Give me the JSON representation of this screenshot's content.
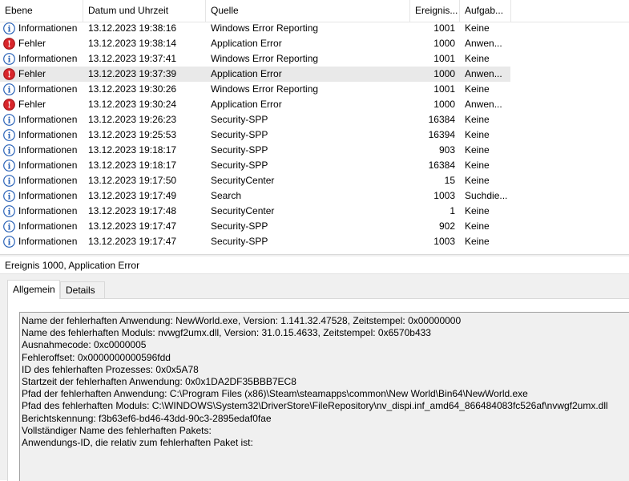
{
  "columns": {
    "level": "Ebene",
    "datetime": "Datum und Uhrzeit",
    "source": "Quelle",
    "event_id": "Ereignis...",
    "task": "Aufgab..."
  },
  "rows": [
    {
      "level": "Informationen",
      "type": "info",
      "datetime": "13.12.2023 19:38:16",
      "source": "Windows Error Reporting",
      "event_id": "1001",
      "task": "Keine",
      "selected": false
    },
    {
      "level": "Fehler",
      "type": "error",
      "datetime": "13.12.2023 19:38:14",
      "source": "Application Error",
      "event_id": "1000",
      "task": "Anwen...",
      "selected": false
    },
    {
      "level": "Informationen",
      "type": "info",
      "datetime": "13.12.2023 19:37:41",
      "source": "Windows Error Reporting",
      "event_id": "1001",
      "task": "Keine",
      "selected": false
    },
    {
      "level": "Fehler",
      "type": "error",
      "datetime": "13.12.2023 19:37:39",
      "source": "Application Error",
      "event_id": "1000",
      "task": "Anwen...",
      "selected": true
    },
    {
      "level": "Informationen",
      "type": "info",
      "datetime": "13.12.2023 19:30:26",
      "source": "Windows Error Reporting",
      "event_id": "1001",
      "task": "Keine",
      "selected": false
    },
    {
      "level": "Fehler",
      "type": "error",
      "datetime": "13.12.2023 19:30:24",
      "source": "Application Error",
      "event_id": "1000",
      "task": "Anwen...",
      "selected": false
    },
    {
      "level": "Informationen",
      "type": "info",
      "datetime": "13.12.2023 19:26:23",
      "source": "Security-SPP",
      "event_id": "16384",
      "task": "Keine",
      "selected": false
    },
    {
      "level": "Informationen",
      "type": "info",
      "datetime": "13.12.2023 19:25:53",
      "source": "Security-SPP",
      "event_id": "16394",
      "task": "Keine",
      "selected": false
    },
    {
      "level": "Informationen",
      "type": "info",
      "datetime": "13.12.2023 19:18:17",
      "source": "Security-SPP",
      "event_id": "903",
      "task": "Keine",
      "selected": false
    },
    {
      "level": "Informationen",
      "type": "info",
      "datetime": "13.12.2023 19:18:17",
      "source": "Security-SPP",
      "event_id": "16384",
      "task": "Keine",
      "selected": false
    },
    {
      "level": "Informationen",
      "type": "info",
      "datetime": "13.12.2023 19:17:50",
      "source": "SecurityCenter",
      "event_id": "15",
      "task": "Keine",
      "selected": false
    },
    {
      "level": "Informationen",
      "type": "info",
      "datetime": "13.12.2023 19:17:49",
      "source": "Search",
      "event_id": "1003",
      "task": "Suchdie...",
      "selected": false
    },
    {
      "level": "Informationen",
      "type": "info",
      "datetime": "13.12.2023 19:17:48",
      "source": "SecurityCenter",
      "event_id": "1",
      "task": "Keine",
      "selected": false
    },
    {
      "level": "Informationen",
      "type": "info",
      "datetime": "13.12.2023 19:17:47",
      "source": "Security-SPP",
      "event_id": "902",
      "task": "Keine",
      "selected": false
    },
    {
      "level": "Informationen",
      "type": "info",
      "datetime": "13.12.2023 19:17:47",
      "source": "Security-SPP",
      "event_id": "1003",
      "task": "Keine",
      "selected": false
    }
  ],
  "detail": {
    "title": "Ereignis 1000, Application Error",
    "tabs": [
      "Allgemein",
      "Details"
    ],
    "active_tab": "Allgemein",
    "message_lines": [
      "Name der fehlerhaften Anwendung: NewWorld.exe, Version: 1.141.32.47528, Zeitstempel: 0x00000000",
      "Name des fehlerhaften Moduls: nvwgf2umx.dll, Version: 31.0.15.4633, Zeitstempel: 0x6570b433",
      "Ausnahmecode: 0xc0000005",
      "Fehleroffset: 0x0000000000596fdd",
      "ID des fehlerhaften Prozesses: 0x0x5A78",
      "Startzeit der fehlerhaften Anwendung: 0x0x1DA2DF35BBB7EC8",
      "Pfad der fehlerhaften Anwendung: C:\\Program Files (x86)\\Steam\\steamapps\\common\\New World\\Bin64\\NewWorld.exe",
      "Pfad des fehlerhaften Moduls: C:\\WINDOWS\\System32\\DriverStore\\FileRepository\\nv_dispi.inf_amd64_866484083fc526af\\nvwgf2umx.dll",
      "Berichtskennung: f3b63ef6-bd46-43dd-90c3-2895edaf0fae",
      "Vollständiger Name des fehlerhaften Pakets:",
      "Anwendungs-ID, die relativ zum fehlerhaften Paket ist:"
    ]
  },
  "colors": {
    "info_icon": "#2b63b8",
    "error_icon": "#d9262b",
    "selected_row": "#e9e9e9"
  }
}
